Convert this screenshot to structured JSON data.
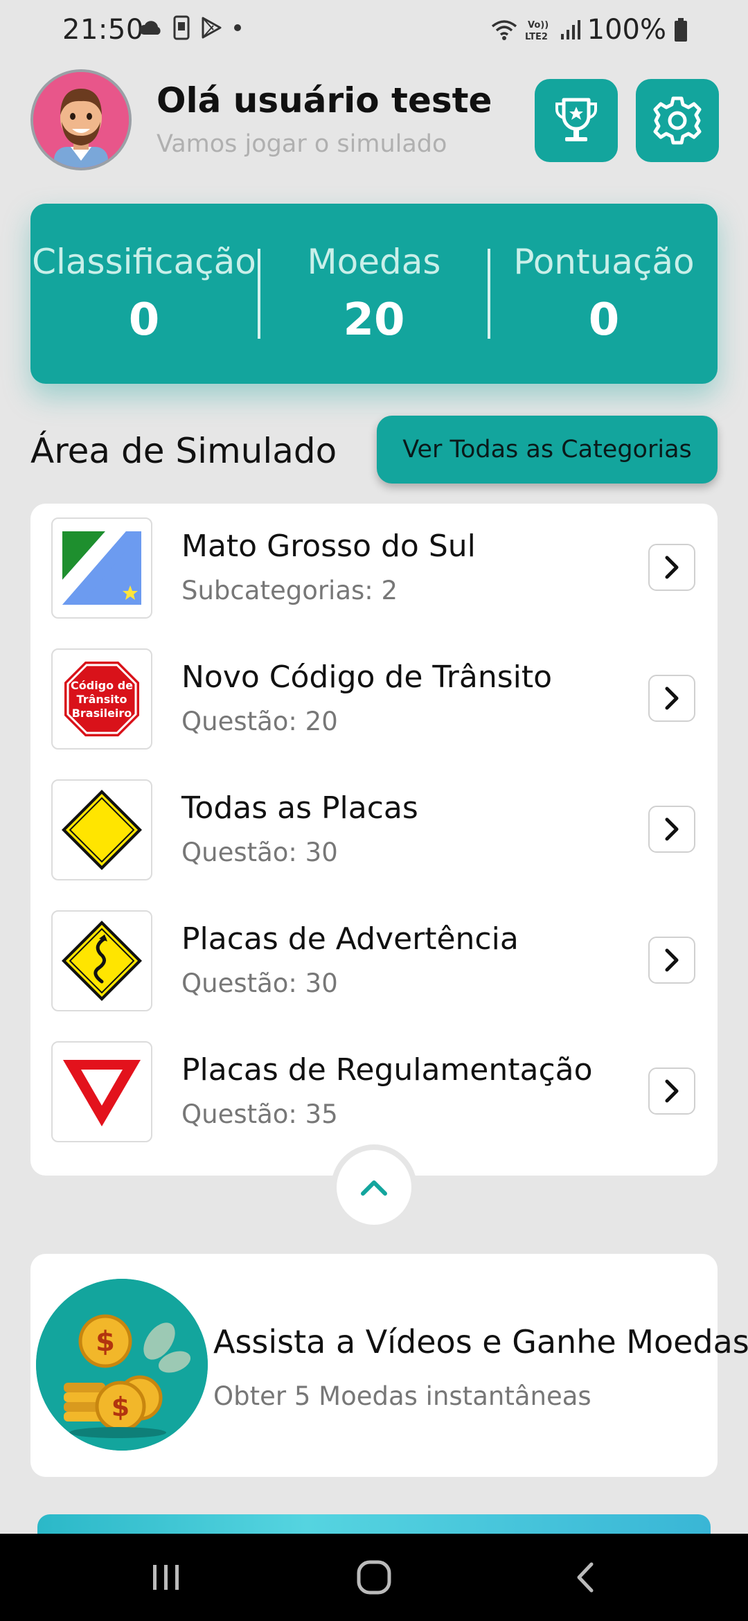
{
  "status_bar": {
    "time": "21:50",
    "battery": "100%",
    "icons_left": [
      "cloud-icon",
      "phone-icon",
      "play-store-icon",
      "dot-icon"
    ],
    "icons_right": [
      "wifi-icon",
      "volte-icon",
      "signal-icon",
      "battery-icon"
    ]
  },
  "header": {
    "greeting": "Olá usuário teste",
    "subtitle": "Vamos jogar o simulado",
    "buttons": [
      "trophy-icon",
      "gear-icon"
    ]
  },
  "stats": [
    {
      "label": "Classificação",
      "value": "0"
    },
    {
      "label": "Moedas",
      "value": "20"
    },
    {
      "label": "Pontuação",
      "value": "0"
    }
  ],
  "section": {
    "title": "Área de Simulado",
    "view_all_label": "Ver Todas as Categorias"
  },
  "categories": [
    {
      "title": "Mato Grosso do Sul",
      "subtitle": "Subcategorias: 2",
      "icon": "ms-flag-icon"
    },
    {
      "title": "Novo Código de Trânsito",
      "subtitle": "Questão: 20",
      "icon": "stop-sign-icon",
      "icon_text": "Código de Trânsito Brasileiro"
    },
    {
      "title": "Todas as Placas",
      "subtitle": "Questão: 30",
      "icon": "yellow-diamond-sign-icon"
    },
    {
      "title": "Placas de Advertência",
      "subtitle": "Questão: 30",
      "icon": "winding-road-sign-icon"
    },
    {
      "title": "Placas de Regulamentação",
      "subtitle": "Questão: 35",
      "icon": "yield-sign-icon"
    }
  ],
  "reward": {
    "title": "Assista a Vídeos e Ganhe Moedas",
    "subtitle": "Obter 5 Moedas instantâneas",
    "icon": "coins-icon"
  },
  "nav": [
    "recents-icon",
    "home-icon",
    "back-icon"
  ],
  "colors": {
    "accent": "#13a59d",
    "background": "#e6e6e6"
  }
}
